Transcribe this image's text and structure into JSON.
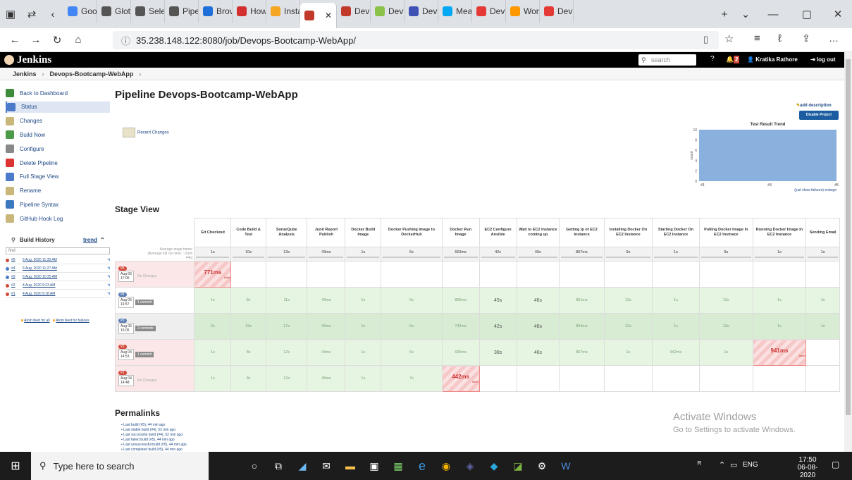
{
  "browser": {
    "tabs": [
      "Goo",
      "Glot",
      "Sele",
      "Pipe",
      "Brov",
      "How",
      "Insta",
      "",
      "Dev",
      "Dev",
      "Dev",
      "Mea",
      "Dev",
      "Wor",
      "Dev"
    ],
    "tab_colors": [
      "#4285f4",
      "#555555",
      "#555555",
      "#555555",
      "#1e6fd9",
      "#d32f2f",
      "#f5a623",
      "#c0392b",
      "#c0392b",
      "#8bc34a",
      "#3f51b5",
      "#03a9f4",
      "#e53935",
      "#ff9800",
      "#e53935"
    ],
    "url": "35.238.148.122:8080/job/Devops-Bootcamp-WebApp/"
  },
  "header": {
    "logo": "Jenkins",
    "search_placeholder": "search",
    "notif_count": "2",
    "user": "Kratika Rathore",
    "logout": "log out"
  },
  "breadcrumb": {
    "root": "Jenkins",
    "job": "Devops-Bootcamp-WebApp"
  },
  "sidebar": {
    "items": [
      {
        "label": "Back to Dashboard"
      },
      {
        "label": "Status"
      },
      {
        "label": "Changes"
      },
      {
        "label": "Build Now"
      },
      {
        "label": "Configure"
      },
      {
        "label": "Delete Pipeline"
      },
      {
        "label": "Full Stage View"
      },
      {
        "label": "Rename"
      },
      {
        "label": "Pipeline Syntax"
      },
      {
        "label": "GitHub Hook Log"
      }
    ],
    "build_history": "Build History",
    "trend": "trend",
    "filter": "find",
    "builds": [
      {
        "num": "#5",
        "date": "6 Aug, 2020 11:35 AM"
      },
      {
        "num": "#4",
        "date": "6 Aug, 2020 11:27 AM"
      },
      {
        "num": "#3",
        "date": "6 Aug, 2020 10:35 AM"
      },
      {
        "num": "#2",
        "date": "4 Aug, 2020 9:23 AM"
      },
      {
        "num": "#1",
        "date": "4 Aug, 2020 9:18 AM"
      }
    ],
    "atom_all": "Atom feed for all",
    "atom_failures": "Atom feed for failures"
  },
  "main": {
    "title": "Pipeline Devops-Bootcamp-WebApp",
    "add_description": "add description",
    "disable_project": "Disable Project",
    "recent_changes": "Recent Changes",
    "stage_view": "Stage View",
    "avg_label": "Average stage times:",
    "avg_full": "(Average full run time: ~2min",
    "avg_full2": "44s)",
    "permalinks": "Permalinks",
    "permalink_items": [
      "Last build (#5), 44 min ago",
      "Last stable build (#4), 52 min ago",
      "Last successful build (#4), 52 min ago",
      "Last failed build (#5), 44 min ago",
      "Last unsuccessful build (#5), 44 min ago",
      "Last completed build (#5), 44 min ago"
    ]
  },
  "stages": {
    "headers": [
      "Git Checkout",
      "Code Build & Test",
      "SonarQube Analysis",
      "Junit Report Publish",
      "Docker Build Image",
      "Docker Pushing Image to DockerHub",
      "Docker Run Image",
      "EC2 Configure Ansible",
      "Wait to EC2 Instance coming up",
      "Getting Ip of EC2 Instance",
      "Installing Docker On EC2 Instance",
      "Starting Docker On EC2 Instance",
      "Pulling Docker Image In EC2 Instnace",
      "Running Docker Image In EC2 Instance",
      "Sending Email"
    ],
    "averages": [
      "1s",
      "10s",
      "13s",
      "43ms",
      "1s",
      "6s",
      "663ms",
      "42s",
      "46s",
      "857ms",
      "9s",
      "1s",
      "9s",
      "1s",
      "1s"
    ],
    "runs": [
      {
        "num": "#5",
        "date": "Aug 06",
        "time": "17:05",
        "changes": "No Changes",
        "cells": [
          "771ms",
          "",
          "",
          "",
          "",
          "",
          "",
          "",
          "",
          "",
          "",
          "",
          "",
          "",
          ""
        ],
        "failed": "failed"
      },
      {
        "num": "#4",
        "date": "Aug 06",
        "time": "16:57",
        "changes": "1 commit",
        "cells": [
          "1s",
          "8s",
          "11s",
          "43ms",
          "1s",
          "6s",
          "805ms",
          "45s",
          "46s",
          "851ms",
          "13s",
          "1s",
          "13s",
          "1s",
          "1s"
        ]
      },
      {
        "num": "#3",
        "date": "Aug 06",
        "time": "16:05",
        "changes": "2 commits",
        "cells": [
          "2s",
          "19s",
          "17s",
          "40ms",
          "1s",
          "6s",
          "742ms",
          "42s",
          "46s",
          "854ms",
          "12s",
          "1s",
          "13s",
          "1s",
          "1s"
        ]
      },
      {
        "num": "#2",
        "date": "Aug 04",
        "time": "14:53",
        "changes": "1 commit",
        "cells": [
          "1s",
          "8s",
          "12s",
          "44ms",
          "1s",
          "6s",
          "665ms",
          "38s",
          "46s",
          "867ms",
          "1s",
          "942ms",
          "1s",
          "941ms",
          ""
        ],
        "failed": "failed"
      },
      {
        "num": "#1",
        "date": "Aug 04",
        "time": "14:48",
        "changes": "No Changes",
        "cells": [
          "1s",
          "8s",
          "12s",
          "45ms",
          "1s",
          "7s",
          "442ms",
          "",
          "",
          "",
          "",
          "",
          "",
          "",
          ""
        ],
        "failed": "failed"
      }
    ]
  },
  "chart_data": {
    "type": "area",
    "title": "Test Result Trend",
    "ylabel": "count",
    "x": [
      "#1",
      "#3",
      "#5"
    ],
    "y_ticks": [
      "0",
      "2",
      "4",
      "6",
      "8",
      "10"
    ],
    "ylim": [
      0,
      10
    ],
    "series": [
      {
        "values": [
          10,
          10,
          10
        ],
        "color": "#8ab0dd"
      }
    ],
    "footer": "(just show failures) enlarge"
  },
  "overlay": {
    "activate_title": "Activate Windows",
    "activate_sub": "Go to Settings to activate Windows."
  },
  "taskbar": {
    "search": "Type here to search",
    "lang": "ENG",
    "time": "17:50",
    "date": "06-08-2020"
  }
}
